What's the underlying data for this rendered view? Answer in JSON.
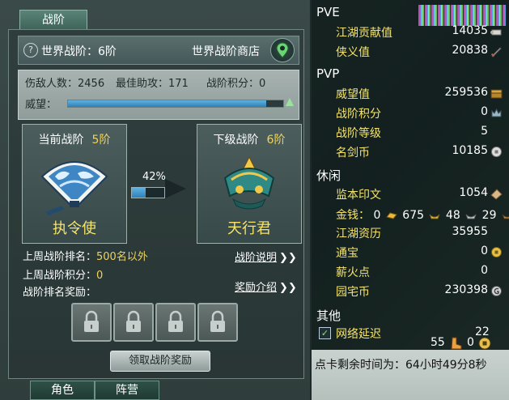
{
  "left": {
    "tab_title": "战阶",
    "help_icon": "?",
    "world_rank": "世界战阶：6阶",
    "shop_label": "世界战阶商店",
    "stats": {
      "kills": "伤敌人数：2456",
      "best_assist": "最佳助攻：171",
      "points": "战阶积分：0",
      "prestige_label": "威望：",
      "prestige_fraction": 0.92
    },
    "current": {
      "header": "当前战阶",
      "level": "5阶",
      "name": "执令使"
    },
    "next": {
      "header": "下级战阶",
      "level": "6阶",
      "name": "天行君"
    },
    "progress": {
      "text": "42%",
      "value": 0.42
    },
    "info": {
      "last_rank_label": "上周战阶排名：",
      "last_rank_value": "500名以外",
      "last_points_label": "上周战阶积分：",
      "last_points_value": "0",
      "reward_label": "战阶排名奖励："
    },
    "links": {
      "rank_desc": "战阶说明",
      "reward_desc": "奖励介绍",
      "chevron": "❯❯"
    },
    "claim_button": "领取战阶奖励",
    "bottom_tabs": [
      "角色",
      "阵营"
    ],
    "colors": {
      "gold": "#f0d35a",
      "bar": "#3b8fc9"
    }
  },
  "right": {
    "pve": {
      "title": "PVE",
      "rows": [
        {
          "label": "江湖贡献值",
          "value": "14035",
          "icon": "scroll-icon"
        },
        {
          "label": "侠义值",
          "value": "20838",
          "icon": "sword-icon"
        }
      ]
    },
    "pvp": {
      "title": "PVP",
      "rows": [
        {
          "label": "威望值",
          "value": "259536",
          "icon": "chest-icon"
        },
        {
          "label": "战阶积分",
          "value": "0",
          "icon": "crown-icon"
        },
        {
          "label": "战阶等级",
          "value": "5",
          "icon": ""
        },
        {
          "label": "名剑币",
          "value": "10185",
          "icon": "coin-icon"
        }
      ]
    },
    "leisure": {
      "title": "休闲",
      "rows_top": [
        {
          "label": "监本印文",
          "value": "1054",
          "icon": "seal-icon"
        }
      ],
      "money": {
        "label": "金钱：",
        "brick": "0",
        "gold": "675",
        "silver": "48",
        "copper": "29"
      },
      "rows_bottom": [
        {
          "label": "江湖资历",
          "value": "35955",
          "icon": ""
        },
        {
          "label": "通宝",
          "value": "0",
          "icon": "coin-icon"
        },
        {
          "label": "薪火点",
          "value": "0",
          "icon": ""
        },
        {
          "label": "园宅币",
          "value": "230398",
          "icon": "g-coin-icon"
        }
      ]
    },
    "other": {
      "title": "其他",
      "partial_label": "网络延迟",
      "partial_value": "22"
    },
    "counters": {
      "a": "55",
      "b": "0"
    },
    "time_remaining": "点卡剩余时间为：64小时49分8秒"
  }
}
